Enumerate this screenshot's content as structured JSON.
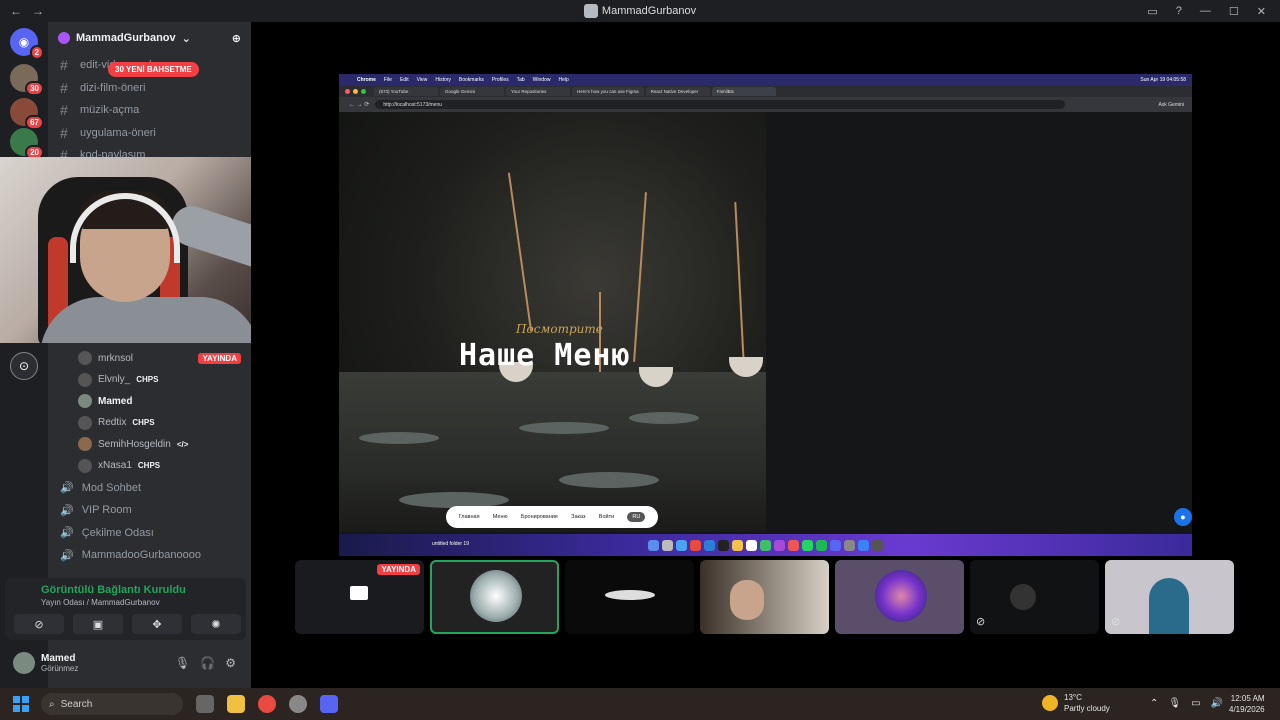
{
  "window": {
    "title": "MammadGurbanov",
    "back": "←",
    "forward": "→",
    "controls": [
      "▭",
      "?",
      "—",
      "☐",
      "✕"
    ]
  },
  "servers": [
    {
      "badge": "2"
    },
    {
      "badge": "30"
    },
    {
      "badge": "67"
    },
    {
      "badge": "20"
    }
  ],
  "sidebar": {
    "guild_name": "MammadGurbanov",
    "mention_pill": "30 YENİ BAHSETME",
    "channels": [
      "edit-video-paylaşım",
      "dizi-film-öneri",
      "müzik-açma",
      "uygulama-öneri",
      "kod-paylaşım"
    ],
    "members": [
      {
        "name": "mrknsol",
        "tag": "",
        "live": "YAYINDA"
      },
      {
        "name": "Elvnly_",
        "tag": "CHPS",
        "live": ""
      },
      {
        "name": "Mamed",
        "tag": "",
        "live": ""
      },
      {
        "name": "Redtix",
        "tag": "CHPS",
        "live": ""
      },
      {
        "name": "SemihHosgeldin",
        "tag": "</>",
        "live": ""
      },
      {
        "name": "xNasa1",
        "tag": "CHPS",
        "live": ""
      }
    ],
    "voice_channels": [
      "Mod Sohbet",
      "VIP Room",
      "Çekilme Odası",
      "MammadooGurbanoooo"
    ]
  },
  "voice": {
    "status": "Görüntülü Bağlantı Kuruldu",
    "sub": "Yayın Odası / MammadGurbanov"
  },
  "user": {
    "name": "Mamed",
    "state": "Görünmez"
  },
  "screen": {
    "mac_menu": [
      "Chrome",
      "File",
      "Edit",
      "View",
      "History",
      "Bookmarks",
      "Profiles",
      "Tab",
      "Window",
      "Help"
    ],
    "mac_time": "Sun Apr 19  04:05:58",
    "tabs": [
      "(673) YouTube",
      "Google Gemini",
      "Your Repositories",
      "Here's how you can use Figma",
      "React Native Developer",
      "FamilBis"
    ],
    "url": "http://localhost:5173/menu",
    "ask": "Ask Gemini",
    "hero_sub": "Посмотрите",
    "hero_title": "Наше Меню",
    "nav": [
      "Главная",
      "Меню",
      "Бронирование",
      "Заказ",
      "Войти",
      "RU"
    ],
    "folder_label": "untitled folder 19"
  },
  "tiles_live": "YAYINDA",
  "taskbar": {
    "search": "Search",
    "temp": "13°C",
    "weather": "Partly cloudy",
    "time": "12:05 AM",
    "date": "4/19/2026"
  },
  "colors": {
    "accent": "#5865f2",
    "live": "#f23f43",
    "connected": "#23a55a"
  }
}
